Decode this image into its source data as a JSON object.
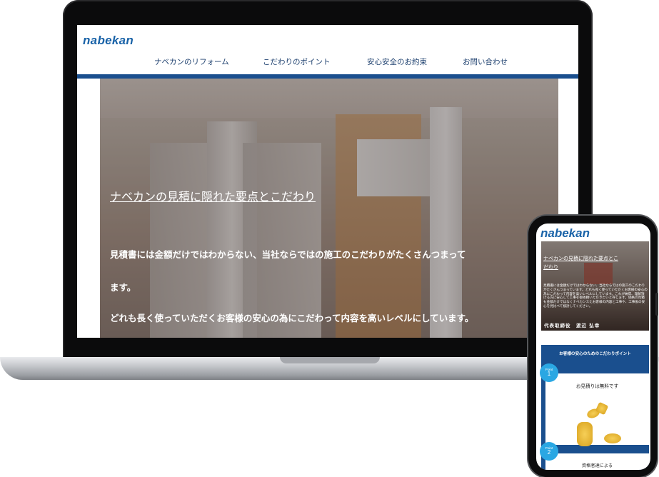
{
  "desktop": {
    "logo": "nabekan",
    "nav": [
      {
        "label": "ナベカンのリフォーム"
      },
      {
        "label": "こだわりのポイント"
      },
      {
        "label": "安心安全のお約束"
      },
      {
        "label": "お問い合わせ"
      }
    ],
    "hero": {
      "title": "ナベカンの見積に隠れた要点とこだわり",
      "line1": "見積書には金額だけではわからない、当社ならではの施工のこだわりがたくさんつまって",
      "line2": "ます。",
      "line3": "どれも長く使っていただくお客様の安心の為にこだわって内容を高いレベルにしています。"
    }
  },
  "mobile": {
    "logo": "nabekan",
    "hero": {
      "title": "ナベカンの見積に隠れた要点とこだわり",
      "body": "見積書には金額だけではわからない、当社ならではの施工のこだわりがたくさんつまっています。どれも長く使っていただくお客様の安心の為にこだわって内容を高いレベルにしています。これが納得、理解頂ける方に安心して工事を御依頼いただきたいと存じます。価格の見積も金額だけではなくナベカンスたお客様の内容と工事や、工事後の安心を見比べて検討してください。",
      "signature": "代表取締役　渡辺 弘幸"
    },
    "points_title": "お客様の安心のためのこだわりポイント",
    "points": [
      {
        "badge_word": "Point",
        "badge_num": "1",
        "title": "お見積りは無料です"
      },
      {
        "badge_word": "Point",
        "badge_num": "2",
        "title": "資格者達による"
      }
    ]
  },
  "colors": {
    "brand": "#1a63a8",
    "nav_bar": "#1a4f8e",
    "badge": "#2aa7e3"
  }
}
